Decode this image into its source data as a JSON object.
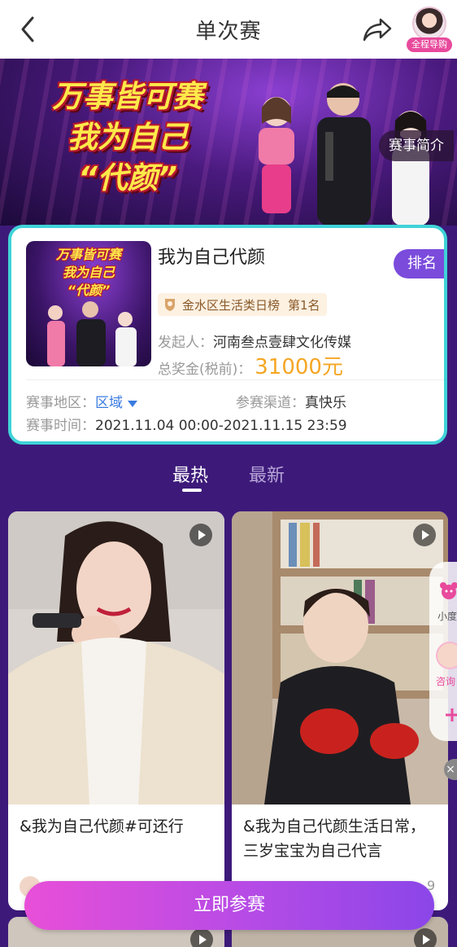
{
  "header": {
    "title": "单次赛",
    "guide_label": "全程导购"
  },
  "banner": {
    "line1": "万事皆可赛",
    "line2": "我为自己",
    "line3": "“代颜”",
    "intro_label": "赛事简介"
  },
  "card": {
    "name": "我为自己代颜",
    "rank_button": "排名",
    "rank_badge": "金水区生活类日榜",
    "rank_position": "第1名",
    "sponsor_label": "发起人：",
    "sponsor_value": "河南叁点壹肆文化传媒",
    "prize_label": "总奖金(税前)：",
    "prize_value": "31000元",
    "region_label": "赛事地区：",
    "region_value": "区域",
    "channel_label": "参赛渠道：",
    "channel_value": "真快乐",
    "time_label": "赛事时间：",
    "time_value": "2021.11.04 00:00-2021.11.15 23:59"
  },
  "thumb": {
    "line1": "万事皆可赛",
    "line2": "我为自己",
    "line3": "“代颜”"
  },
  "tabs": {
    "hot": "最热",
    "new": "最新"
  },
  "videos": [
    {
      "title": "&我为自己代颜#可还行",
      "count": ""
    },
    {
      "title": "&我为自己代颜生活日常，三岁宝宝为自己代言",
      "count": "9"
    }
  ],
  "side_widget": {
    "label_1": "小度",
    "label_2": "咨询"
  },
  "join_button": "立即参赛",
  "colors": {
    "page_background": "#3d1a7a",
    "card_border": "#3fd3d8",
    "rank_button": "#7b4bdc",
    "prize": "#f5a623",
    "region_link": "#3a7be0",
    "join_gradient_start": "#e84fd8",
    "join_gradient_end": "#8b46e8"
  }
}
